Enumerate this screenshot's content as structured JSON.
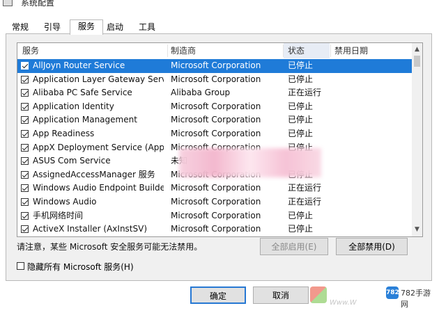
{
  "window": {
    "title": "系统配置"
  },
  "tabs": [
    {
      "label": "常规"
    },
    {
      "label": "引导"
    },
    {
      "label": "服务",
      "active": true
    },
    {
      "label": "启动"
    },
    {
      "label": "工具"
    }
  ],
  "table": {
    "headers": {
      "service": "服务",
      "manufacturer": "制造商",
      "status": "状态",
      "disabled_date": "禁用日期"
    },
    "sorted_by": "status",
    "rows": [
      {
        "name": "AllJoyn Router Service",
        "manufacturer": "Microsoft Corporation",
        "status": "已停止",
        "date": "",
        "checked": true,
        "selected": true
      },
      {
        "name": "Application Layer Gateway Service",
        "manufacturer": "Microsoft Corporation",
        "status": "已停止",
        "date": "",
        "checked": true
      },
      {
        "name": "Alibaba PC Safe Service",
        "manufacturer": "Alibaba Group",
        "status": "正在运行",
        "date": "",
        "checked": true
      },
      {
        "name": "Application Identity",
        "manufacturer": "Microsoft Corporation",
        "status": "已停止",
        "date": "",
        "checked": true
      },
      {
        "name": "Application Management",
        "manufacturer": "Microsoft Corporation",
        "status": "已停止",
        "date": "",
        "checked": true
      },
      {
        "name": "App Readiness",
        "manufacturer": "Microsoft Corporation",
        "status": "已停止",
        "date": "",
        "checked": true
      },
      {
        "name": "AppX Deployment Service (AppX...",
        "manufacturer": "Microsoft Corporation",
        "status": "已停止",
        "date": "",
        "checked": true
      },
      {
        "name": "ASUS Com Service",
        "manufacturer": "未知",
        "status": "",
        "date": "",
        "checked": true
      },
      {
        "name": "AssignedAccessManager 服务",
        "manufacturer": "Microsoft Corporation",
        "status": "已停止",
        "date": "",
        "checked": true
      },
      {
        "name": "Windows Audio Endpoint Builder",
        "manufacturer": "Microsoft Corporation",
        "status": "正在运行",
        "date": "",
        "checked": true
      },
      {
        "name": "Windows Audio",
        "manufacturer": "Microsoft Corporation",
        "status": "正在运行",
        "date": "",
        "checked": true
      },
      {
        "name": "手机网络时间",
        "manufacturer": "Microsoft Corporation",
        "status": "已停止",
        "date": "",
        "checked": true
      },
      {
        "name": "ActiveX Installer (AxInstSV)",
        "manufacturer": "Microsoft Corporation",
        "status": "已停止",
        "date": "",
        "checked": true
      }
    ]
  },
  "note": "请注意，某些 Microsoft 安全服务可能无法禁用。",
  "buttons": {
    "enable_all": "全部启用(E)",
    "disable_all": "全部禁用(D)",
    "ok": "确定",
    "cancel": "取消"
  },
  "hide_ms": {
    "label": "隐藏所有 Microsoft 服务(H)",
    "checked": false
  },
  "watermark": {
    "site_text": "782手游网",
    "logo_text": "782",
    "win_text": "Www.W"
  },
  "colors": {
    "selection": "#1f7bd8",
    "primary_border": "#2778d3"
  }
}
